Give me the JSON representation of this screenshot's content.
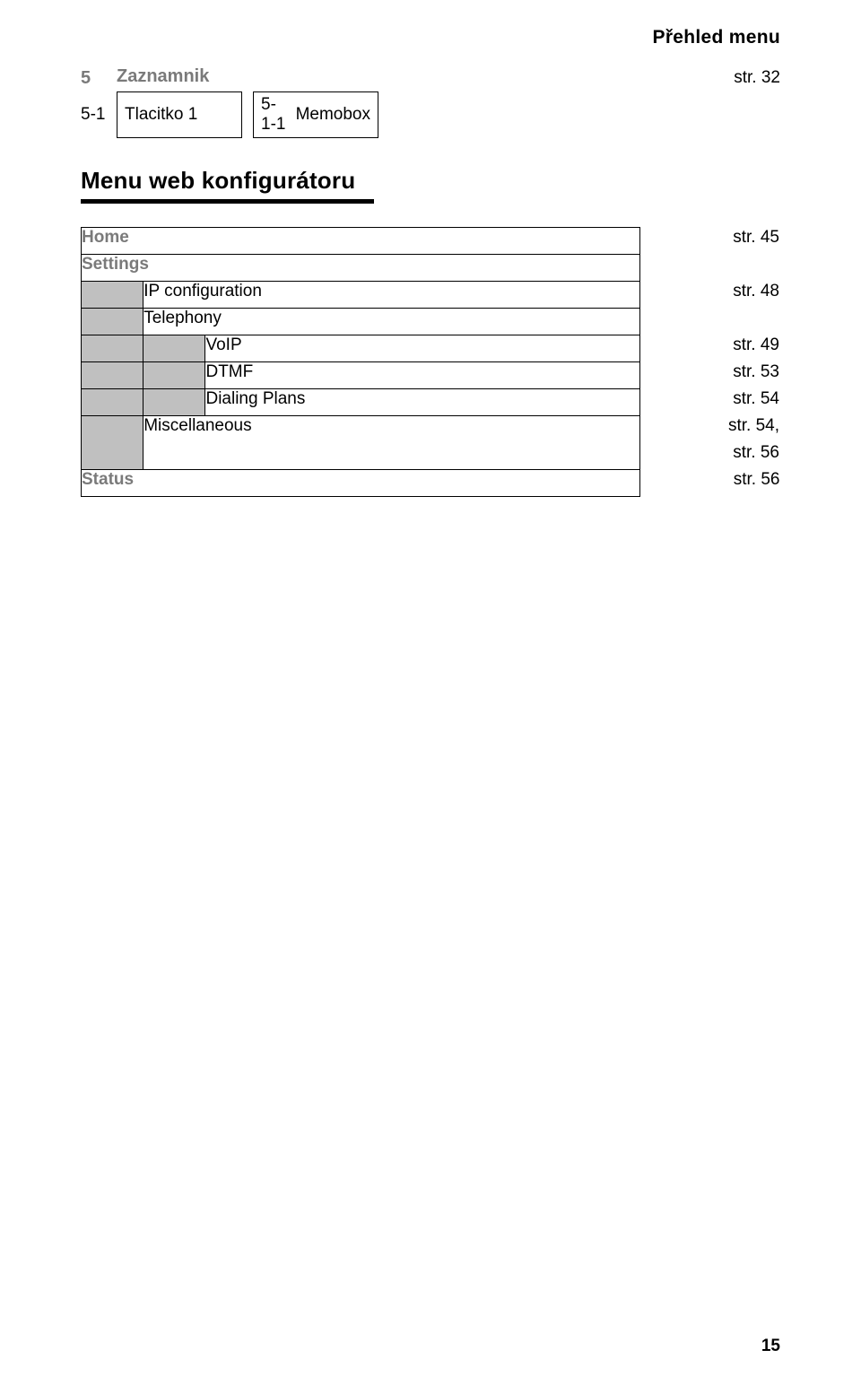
{
  "header": "Přehled menu",
  "phoneMenu": {
    "topRow": {
      "idx": "5",
      "label": "Zaznamnik",
      "ref": "str. 32"
    },
    "subRow": {
      "idx": "5-1",
      "col1": "Tlacitko 1",
      "col2idx": "5-1-1",
      "col2label": "Memobox"
    }
  },
  "sectionTitle": "Menu web konfigurátoru",
  "cfg": {
    "home": {
      "label": "Home",
      "ref": "str. 45"
    },
    "settings": {
      "label": "Settings"
    },
    "ipconfig": {
      "label": "IP configuration",
      "ref": "str. 48"
    },
    "telephony": {
      "label": "Telephony"
    },
    "voip": {
      "label": "VoIP",
      "ref": "str. 49"
    },
    "dtmf": {
      "label": "DTMF",
      "ref": "str. 53"
    },
    "dialing": {
      "label": "Dialing Plans",
      "ref": "str. 54"
    },
    "misc": {
      "label": "Miscellaneous",
      "ref1": "str. 54,",
      "ref2": "str. 56"
    },
    "status": {
      "label": "Status",
      "ref": "str. 56"
    }
  },
  "pageNumber": "15"
}
